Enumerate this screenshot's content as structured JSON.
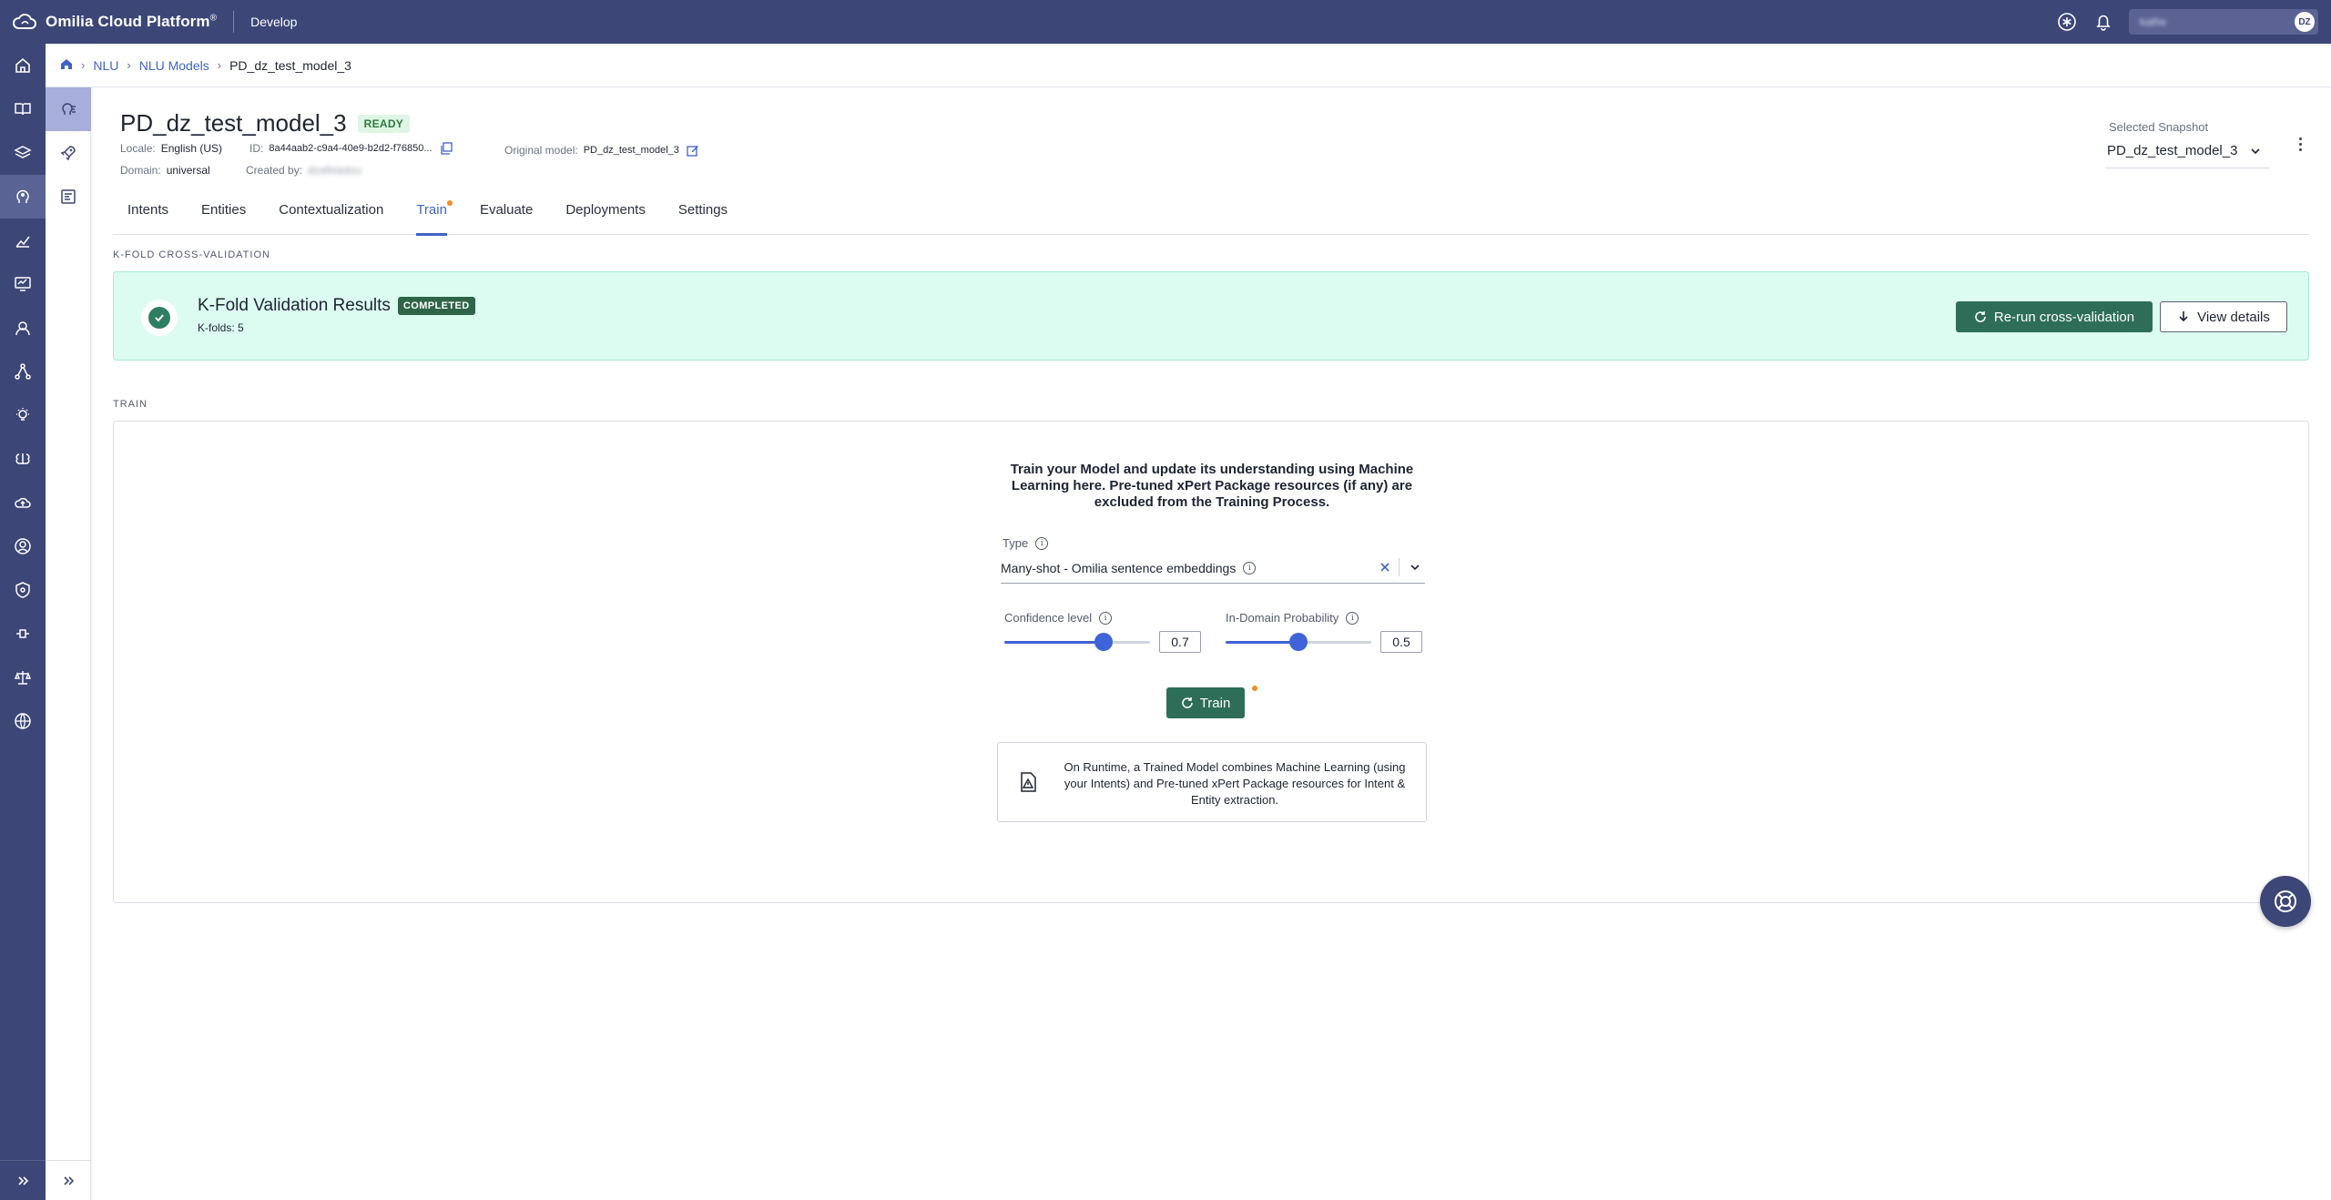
{
  "topbar": {
    "brand": "Omilia Cloud Platform",
    "brand_mark": "®",
    "section": "Develop",
    "user_name": "kathe",
    "avatar_initials": "DZ"
  },
  "breadcrumb": {
    "items": [
      "NLU",
      "NLU Models"
    ],
    "current": "PD_dz_test_model_3"
  },
  "model": {
    "title": "PD_dz_test_model_3",
    "status": "READY",
    "locale_label": "Locale:",
    "locale_value": "English (US)",
    "id_label": "ID:",
    "id_value": "8a44aab2-c9a4-40e9-b2d2-f76850...",
    "original_label": "Original model:",
    "original_value": "PD_dz_test_model_3",
    "domain_label": "Domain:",
    "domain_value": "universal",
    "created_label": "Created by:",
    "created_value": "dzafiriadou"
  },
  "snapshot": {
    "label": "Selected Snapshot",
    "value": "PD_dz_test_model_3"
  },
  "tabs": [
    "Intents",
    "Entities",
    "Contextualization",
    "Train",
    "Evaluate",
    "Deployments",
    "Settings"
  ],
  "kfold": {
    "section_label": "K-FOLD CROSS-VALIDATION",
    "title": "K-Fold Validation Results",
    "badge": "COMPLETED",
    "subtitle": "K-folds: 5",
    "rerun_label": "Re-run cross-validation",
    "details_label": "View details"
  },
  "train": {
    "section_label": "TRAIN",
    "description": "Train your Model and update its understanding using Machine Learning here. Pre-tuned xPert Package resources (if any) are excluded from the Training Process.",
    "type_label": "Type",
    "type_value": "Many-shot - Omilia sentence embeddings",
    "confidence_label": "Confidence level",
    "confidence_value": "0.7",
    "confidence_fraction": 0.68,
    "indomain_label": "In-Domain Probability",
    "indomain_value": "0.5",
    "indomain_fraction": 0.5,
    "train_button": "Train",
    "note": "On Runtime, a Trained Model combines Machine Learning (using your Intents) and Pre-tuned xPert Package resources for Intent & Entity extraction."
  },
  "colors": {
    "nav": "#3c4677",
    "accent": "#3f63c9",
    "success": "#2e6e58",
    "success_bg": "#dcfcf1",
    "badge_dot": "#f28c28"
  }
}
